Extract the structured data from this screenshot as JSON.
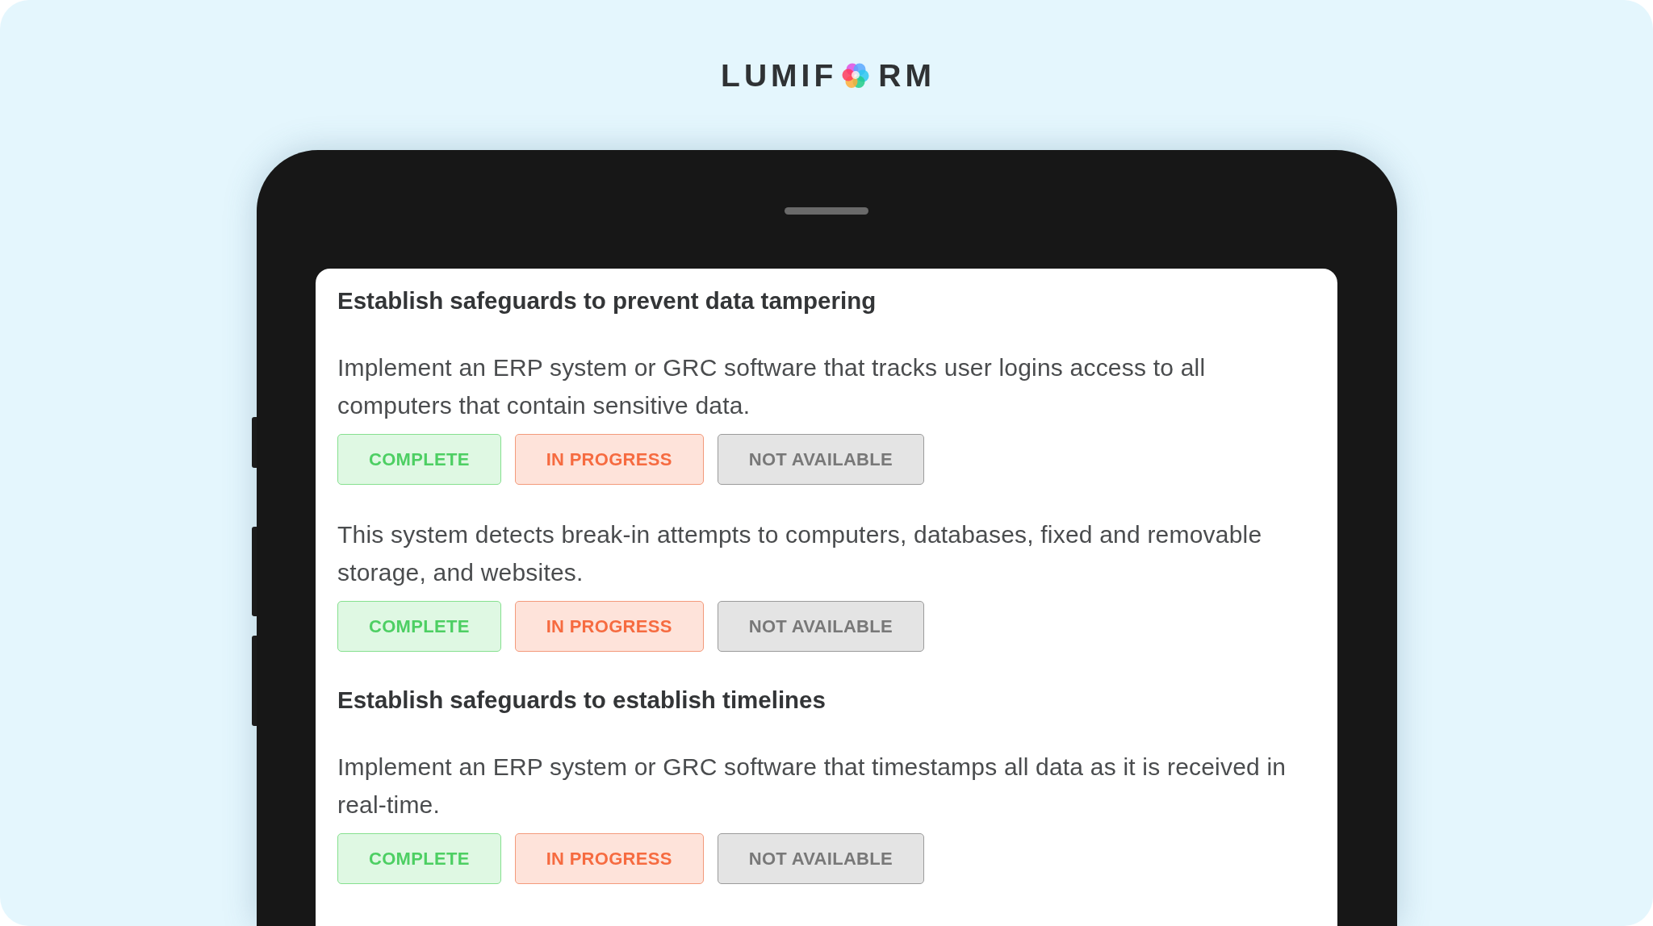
{
  "logo": {
    "text_before_icon": "LUMIF",
    "text_after_icon": "RM"
  },
  "sections": [
    {
      "heading": "Establish safeguards to prevent data tampering",
      "items": [
        {
          "text": "Implement an ERP system or GRC software that tracks user logins access to all computers that contain sensitive data.",
          "buttons": [
            {
              "kind": "complete",
              "label": "COMPLETE"
            },
            {
              "kind": "in_progress",
              "label": "IN PROGRESS"
            },
            {
              "kind": "not_available",
              "label": "NOT AVAILABLE"
            }
          ]
        },
        {
          "text": "This system detects break-in attempts to computers, databases, fixed and removable storage, and websites.",
          "buttons": [
            {
              "kind": "complete",
              "label": "COMPLETE"
            },
            {
              "kind": "in_progress",
              "label": "IN PROGRESS"
            },
            {
              "kind": "not_available",
              "label": "NOT AVAILABLE"
            }
          ]
        }
      ]
    },
    {
      "heading": "Establish safeguards to establish timelines",
      "items": [
        {
          "text": "Implement an ERP system or GRC software that timestamps all data as it is received in real-time.",
          "buttons": [
            {
              "kind": "complete",
              "label": "COMPLETE"
            },
            {
              "kind": "in_progress",
              "label": "IN PROGRESS"
            },
            {
              "kind": "not_available",
              "label": "NOT AVAILABLE"
            }
          ]
        }
      ]
    }
  ]
}
